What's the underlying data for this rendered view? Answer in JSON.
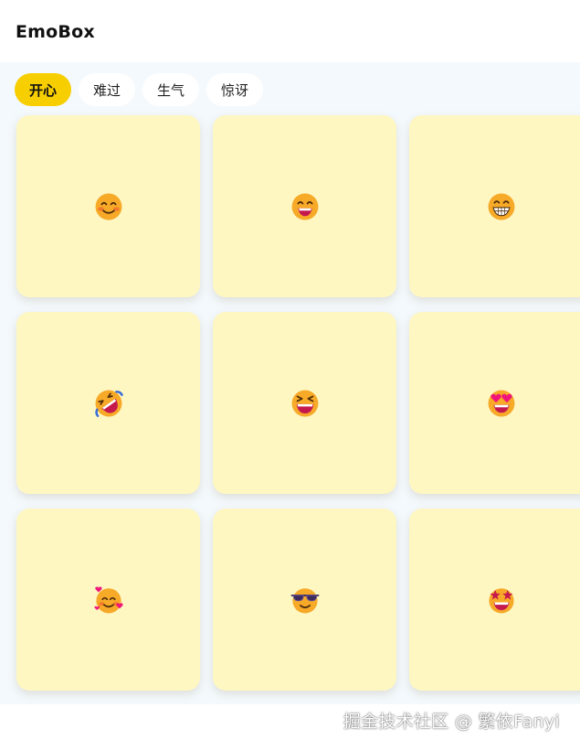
{
  "app": {
    "title": "EmoBox"
  },
  "tabs": [
    {
      "label": "开心",
      "active": true
    },
    {
      "label": "难过",
      "active": false
    },
    {
      "label": "生气",
      "active": false
    },
    {
      "label": "惊讶",
      "active": false
    }
  ],
  "emojis": [
    {
      "icon": "smiling-face-with-smiling-eyes"
    },
    {
      "icon": "grinning-face-with-smiling-eyes"
    },
    {
      "icon": "beaming-face-with-smiling-eyes"
    },
    {
      "icon": "rolling-on-the-floor-laughing"
    },
    {
      "icon": "grinning-squinting-face"
    },
    {
      "icon": "smiling-face-with-heart-eyes"
    },
    {
      "icon": "smiling-face-with-hearts"
    },
    {
      "icon": "smiling-face-with-sunglasses"
    },
    {
      "icon": "star-struck"
    }
  ],
  "colors": {
    "accent": "#f7cf00",
    "card": "#fef7c2",
    "face": "#f7a928",
    "blush": "#f0622d",
    "mouth": "#c5194e",
    "heart": "#f0147a"
  },
  "watermark": "掘金技术社区 @ 繁依Fanyi"
}
